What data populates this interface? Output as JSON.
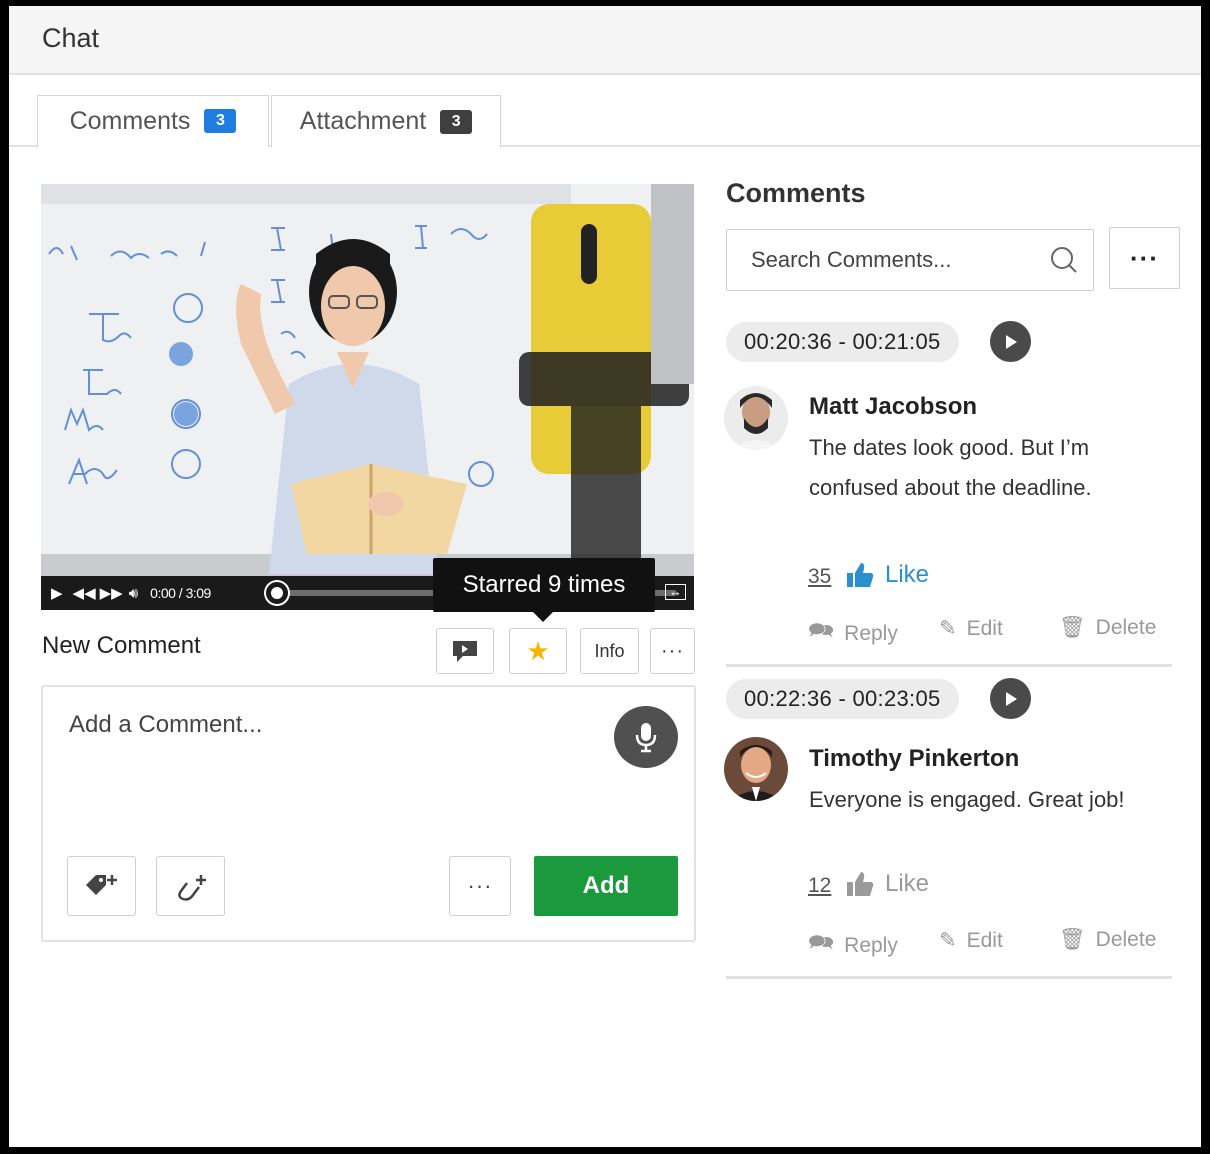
{
  "header": {
    "title": "Chat"
  },
  "tabs": [
    {
      "label": "Comments",
      "count": "3"
    },
    {
      "label": "Attachment",
      "count": "3"
    }
  ],
  "player": {
    "time": "0:00 / 3:09",
    "tooltip": "Starred 9 times",
    "progress_fraction": 0
  },
  "new_comment": {
    "label": "New Comment",
    "info_label": "Info",
    "placeholder": "Add a Comment...",
    "add_label": "Add"
  },
  "comments_panel": {
    "title": "Comments",
    "search_placeholder": "Search Comments..."
  },
  "comments": [
    {
      "timestamp": "00:20:36 - 00:21:05",
      "author": "Matt Jacobson",
      "text": "The dates look good. But I’m confused about the deadline.",
      "likes": "35",
      "like_label": "Like",
      "liked": true,
      "reply_label": "Reply",
      "edit_label": "Edit",
      "delete_label": "Delete"
    },
    {
      "timestamp": "00:22:36 - 00:23:05",
      "author": "Timothy Pinkerton",
      "text": "Everyone is engaged. Great job!",
      "likes": "12",
      "like_label": "Like",
      "liked": false,
      "reply_label": "Reply",
      "edit_label": "Edit",
      "delete_label": "Delete"
    }
  ],
  "colors": {
    "accent_blue": "#1f7de0",
    "add_green": "#1a9a3c",
    "star_yellow": "#f2b705",
    "like_blue": "#2a8fd0"
  },
  "icons": [
    "play-icon",
    "rewind-icon",
    "forward-icon",
    "volume-icon",
    "expand-icon",
    "comment-icon",
    "star-icon",
    "more-icon",
    "mic-icon",
    "tag-add-icon",
    "attach-add-icon",
    "search-icon",
    "thumbs-up-icon",
    "reply-icon",
    "edit-icon",
    "delete-icon"
  ]
}
